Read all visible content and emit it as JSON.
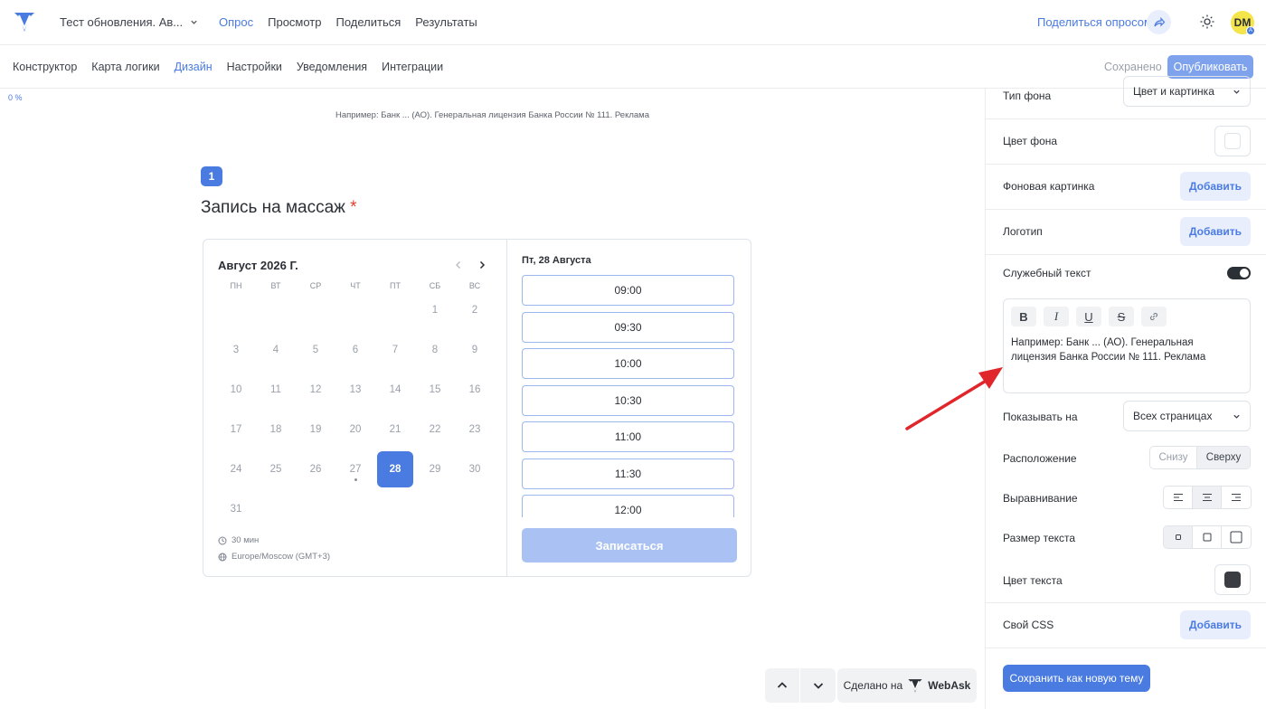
{
  "header": {
    "survey_title": "Тест обновления. Ав...",
    "nav": [
      "Опрос",
      "Просмотр",
      "Поделиться",
      "Результаты"
    ],
    "share_link": "Поделиться опросом",
    "avatar": "DM",
    "avatar_badge": "A"
  },
  "subheader": {
    "tabs": [
      "Конструктор",
      "Карта логики",
      "Дизайн",
      "Настройки",
      "Уведомления",
      "Интеграции"
    ],
    "saved": "Сохранено",
    "publish": "Опубликовать"
  },
  "preview": {
    "progress": "0 %",
    "service_text": "Например: Банк ... (АО). Генеральная лицензия Банка России № 111. Реклама",
    "question_number": "1",
    "question_title": "Запись на массаж",
    "required_mark": "*",
    "calendar": {
      "month": "Август 2026 Г.",
      "weekdays": [
        "ПН",
        "ВТ",
        "СР",
        "ЧТ",
        "ПТ",
        "СБ",
        "ВС"
      ],
      "days": [
        "",
        "",
        "",
        "",
        "",
        "1",
        "2",
        "3",
        "4",
        "5",
        "6",
        "7",
        "8",
        "9",
        "10",
        "11",
        "12",
        "13",
        "14",
        "15",
        "16",
        "17",
        "18",
        "19",
        "20",
        "21",
        "22",
        "23",
        "24",
        "25",
        "26",
        "27",
        "28",
        "29",
        "30",
        "31"
      ],
      "selected_day": "28",
      "today_dot_day": "27",
      "duration": "30 мин",
      "timezone": "Europe/Moscow (GMT+3)"
    },
    "slots": {
      "date": "Пт, 28 Августа",
      "times": [
        "09:00",
        "09:30",
        "10:00",
        "10:30",
        "11:00",
        "11:30",
        "12:00"
      ],
      "submit": "Записаться"
    },
    "nav_up": "up",
    "nav_down": "down",
    "made_on": "Сделано на",
    "brand": "WebAsk"
  },
  "panel": {
    "bg_type_label": "Тип фона",
    "bg_type_value": "Цвет и картинка",
    "bg_color_label": "Цвет фона",
    "bg_color": "#ffffff",
    "bg_image_label": "Фоновая картинка",
    "add": "Добавить",
    "logo_label": "Логотип",
    "service_text_label": "Служебный текст",
    "service_text_on": true,
    "format_buttons": [
      "B",
      "I",
      "U",
      "S"
    ],
    "editor_text": "Например: Банк ... (АО). Генеральная лицензия Банка России № 111. Реклама",
    "show_on_label": "Показывать на",
    "show_on_value": "Всех страницах",
    "position_label": "Расположение",
    "position_options": [
      "Снизу",
      "Сверху"
    ],
    "position_selected": "Сверху",
    "align_label": "Выравнивание",
    "size_label": "Размер текста",
    "text_color_label": "Цвет текста",
    "text_color": "#3a3d42",
    "css_label": "Свой CSS",
    "save_theme": "Сохранить как новую тему"
  },
  "colors": {
    "accent": "#4a7be0",
    "annotation_arrow": "#e0262b"
  }
}
